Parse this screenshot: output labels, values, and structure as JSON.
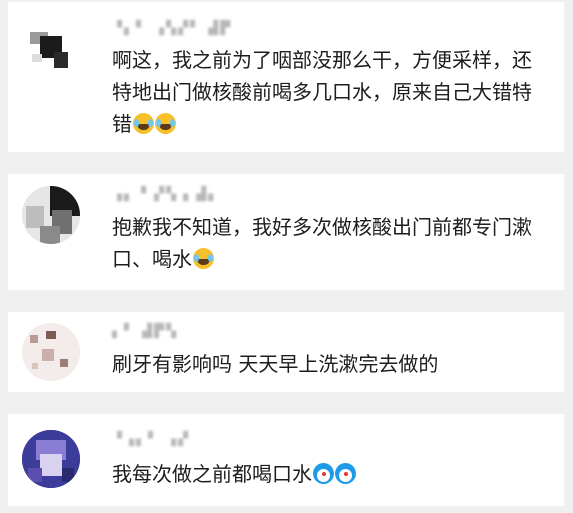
{
  "comments": [
    {
      "username": "▝▖▘ ▗▚▞▘ ▟▛",
      "text": "啊这，我之前为了咽部没那么干，方便采样，还特地出门做核酸前喝多几口水，原来自己大错特错",
      "emojis": [
        "crying-laughing-emoji-icon",
        "crying-laughing-emoji-icon"
      ],
      "avatar_colors": [
        "#1b1b1b",
        "#9a9a9a",
        "#ffffff"
      ]
    },
    {
      "username": "▗▖▝ ▞▚▗ ▟▖",
      "text": "抱歉我不知道，我好多次做核酸出门前都专门漱口、喝水",
      "emojis": [
        "crying-laughing-emoji-icon"
      ],
      "avatar_colors": [
        "#1a1a1a",
        "#cfcfcf",
        "#707070"
      ]
    },
    {
      "username": "▖▘ ▟▛▚",
      "text": "刷牙有影响吗 天天早上洗漱完去做的",
      "emojis": [],
      "avatar_colors": [
        "#f0e6e1",
        "#b89c93",
        "#7f5b57"
      ]
    },
    {
      "username": "▝▗▖▘ ▗▞",
      "text": "我每次做之前都喝口水",
      "emojis": [
        "doraemon-emoji-icon",
        "doraemon-emoji-icon"
      ],
      "avatar_colors": [
        "#3c3c9a",
        "#8a7ed4",
        "#d8d2f0"
      ]
    }
  ]
}
